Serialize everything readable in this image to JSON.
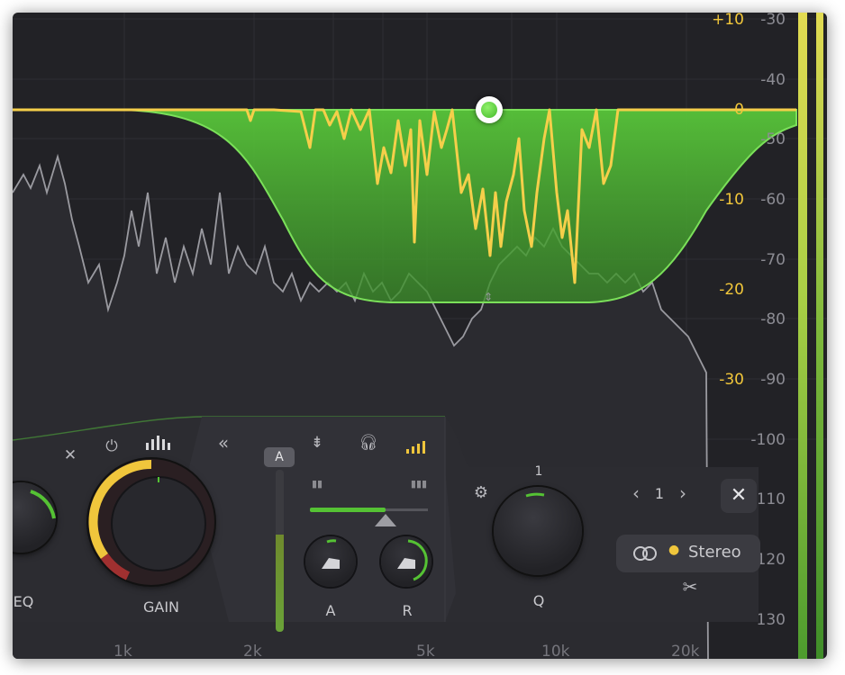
{
  "gain_scale": [
    "+10",
    "0",
    "-10",
    "-20",
    "-30"
  ],
  "db_scale": [
    "-30",
    "-40",
    "-50",
    "-60",
    "-70",
    "-80",
    "-90",
    "-100",
    "-110",
    "-120",
    "-130"
  ],
  "freq_labels": [
    "1k",
    "2k",
    "5k",
    "10k",
    "20k"
  ],
  "controls": {
    "eq_label": "EQ",
    "gain_label": "GAIN",
    "input_chip": "A",
    "attack_label": "A",
    "release_label": "R",
    "q_label": "Q",
    "q_value_top": "1",
    "band_number": "1",
    "stereo_label": "Stereo"
  },
  "icons": {
    "close_small": "✕",
    "power": "⏻",
    "collapse": "«",
    "prev": "‹",
    "next": "›",
    "close": "✕",
    "scissors": "✂"
  },
  "colors": {
    "accent_green": "#55c234",
    "curve_yellow": "#f5cf4a",
    "background": "#222226"
  }
}
